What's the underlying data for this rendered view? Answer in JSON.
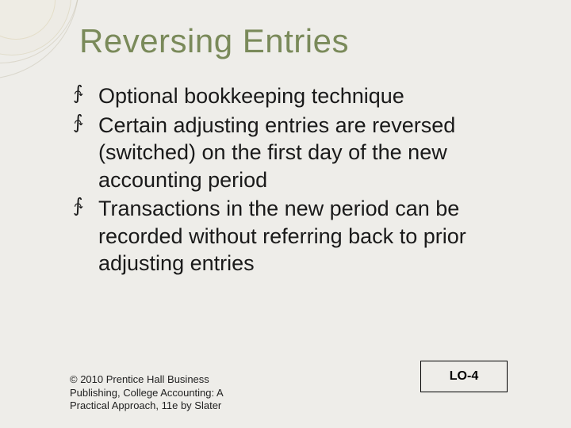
{
  "slide": {
    "title": "Reversing Entries",
    "bullets": [
      "Optional bookkeeping technique",
      "Certain adjusting entries are reversed (switched) on the first day of the new accounting period",
      "Transactions in the new period can be recorded without referring back to prior adjusting entries"
    ],
    "learning_objective": "LO-4",
    "copyright": "© 2010 Prentice Hall Business Publishing, College Accounting: A Practical Approach, 11e by Slater"
  },
  "theme": {
    "title_color": "#7a8a5a",
    "background": "#eeede9"
  }
}
